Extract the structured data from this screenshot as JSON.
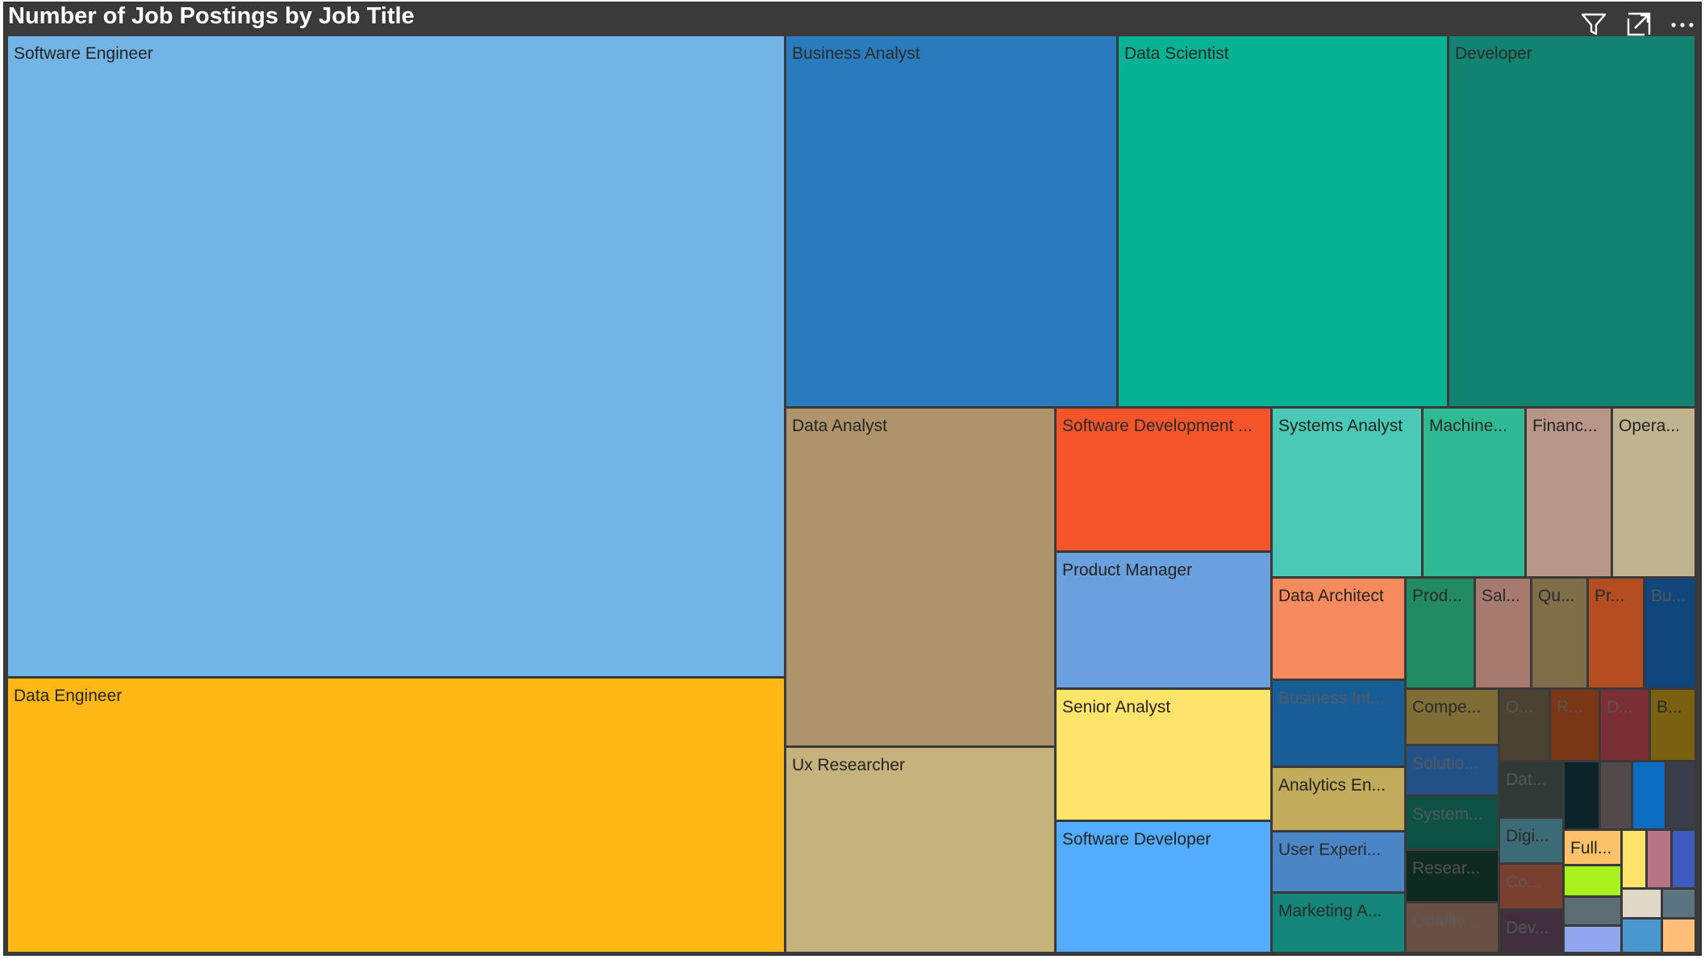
{
  "header": {
    "title": "Number of Job Postings by Job Title",
    "icons": [
      "filter-icon",
      "focus-mode-icon",
      "more-options-icon"
    ]
  },
  "chart_data": {
    "type": "treemap",
    "title": "Number of Job Postings by Job Title",
    "series": [
      {
        "name": "Software Engineer",
        "value": 3150,
        "color": "#72B4E5"
      },
      {
        "name": "Data Engineer",
        "value": 1350,
        "color": "#FFB814"
      },
      {
        "name": "Business Analyst",
        "value": 780,
        "color": "#2A7BBD"
      },
      {
        "name": "Data Scientist",
        "value": 775,
        "color": "#05B394"
      },
      {
        "name": "Developer",
        "value": 585,
        "color": "#118370"
      },
      {
        "name": "Data Analyst",
        "value": 575,
        "color": "#AD946D"
      },
      {
        "name": "Ux Researcher",
        "value": 370,
        "color": "#C6B27D"
      },
      {
        "name": "Software Development ...",
        "value": 195,
        "color": "#F6552C"
      },
      {
        "name": "Product Manager",
        "value": 185,
        "color": "#6BA0DE"
      },
      {
        "name": "Senior Analyst",
        "value": 175,
        "color": "#FEE46A"
      },
      {
        "name": "Software Developer",
        "value": 175,
        "color": "#53ACFE"
      },
      {
        "name": "Systems Analyst",
        "value": 140,
        "color": "#4AC9B7"
      },
      {
        "name": "Machine...",
        "value": 110,
        "color": "#2FBA94"
      },
      {
        "name": "Financ...",
        "value": 90,
        "color": "#B8978A"
      },
      {
        "name": "Opera...",
        "value": 90,
        "color": "#BFB48F"
      },
      {
        "name": "Data Architect",
        "value": 85,
        "color": "#F48A5D"
      },
      {
        "name": "Prod...",
        "value": 60,
        "color": "#238B63"
      },
      {
        "name": "Sal...",
        "value": 50,
        "color": "#A77A70"
      },
      {
        "name": "Qu...",
        "value": 50,
        "color": "#7F6E48"
      },
      {
        "name": "Pr...",
        "value": 50,
        "color": "#B54D22"
      },
      {
        "name": "Bu...",
        "value": 50,
        "color": "#10467C"
      },
      {
        "name": "Business Int...",
        "value": 55,
        "color": "#195D97"
      },
      {
        "name": "Analytics En...",
        "value": 50,
        "color": "#C2AC5C"
      },
      {
        "name": "User Experi...",
        "value": 50,
        "color": "#4A86C5"
      },
      {
        "name": "Marketing A...",
        "value": 45,
        "color": "#148578"
      },
      {
        "name": "Compe...",
        "value": 35,
        "color": "#7E6D35"
      },
      {
        "name": "Solutio...",
        "value": 35,
        "color": "#235288"
      },
      {
        "name": "System...",
        "value": 35,
        "color": "#0E5145"
      },
      {
        "name": "Resear...",
        "value": 30,
        "color": "#0F2B21"
      },
      {
        "name": "Quality ...",
        "value": 30,
        "color": "#6A5043"
      },
      {
        "name": "O...",
        "value": 20,
        "color": "#4C4232"
      },
      {
        "name": "R...",
        "value": 20,
        "color": "#7A3717"
      },
      {
        "name": "D...",
        "value": 20,
        "color": "#7A2F35"
      },
      {
        "name": "B...",
        "value": 20,
        "color": "#7A6112"
      },
      {
        "name": "Dat...",
        "value": 18,
        "color": "#2F3A37"
      },
      {
        "name": "Digi...",
        "value": 18,
        "color": "#3D6B75"
      },
      {
        "name": "Co...",
        "value": 16,
        "color": "#794030"
      },
      {
        "name": "Dev...",
        "value": 14,
        "color": "#40303E"
      },
      {
        "name": "",
        "value": 10,
        "color": "#0C2329"
      },
      {
        "name": "",
        "value": 10,
        "color": "#54494A"
      },
      {
        "name": "",
        "value": 10,
        "color": "#0B6CC2"
      },
      {
        "name": "",
        "value": 10,
        "color": "#3A3E4B"
      },
      {
        "name": "Full...",
        "value": 10,
        "color": "#FCC26A"
      },
      {
        "name": "",
        "value": 8,
        "color": "#FDE26C"
      },
      {
        "name": "",
        "value": 8,
        "color": "#B87487"
      },
      {
        "name": "",
        "value": 8,
        "color": "#3D5BBE"
      },
      {
        "name": "",
        "value": 6,
        "color": "#A8F21C"
      },
      {
        "name": "",
        "value": 6,
        "color": "#5B6D73"
      },
      {
        "name": "",
        "value": 5,
        "color": "#8FA5EE"
      },
      {
        "name": "",
        "value": 5,
        "color": "#E2D8CA"
      },
      {
        "name": "",
        "value": 5,
        "color": "#5C7480"
      },
      {
        "name": "",
        "value": 5,
        "color": "#4A97D0"
      },
      {
        "name": "",
        "value": 5,
        "color": "#FDBE7A"
      }
    ]
  }
}
